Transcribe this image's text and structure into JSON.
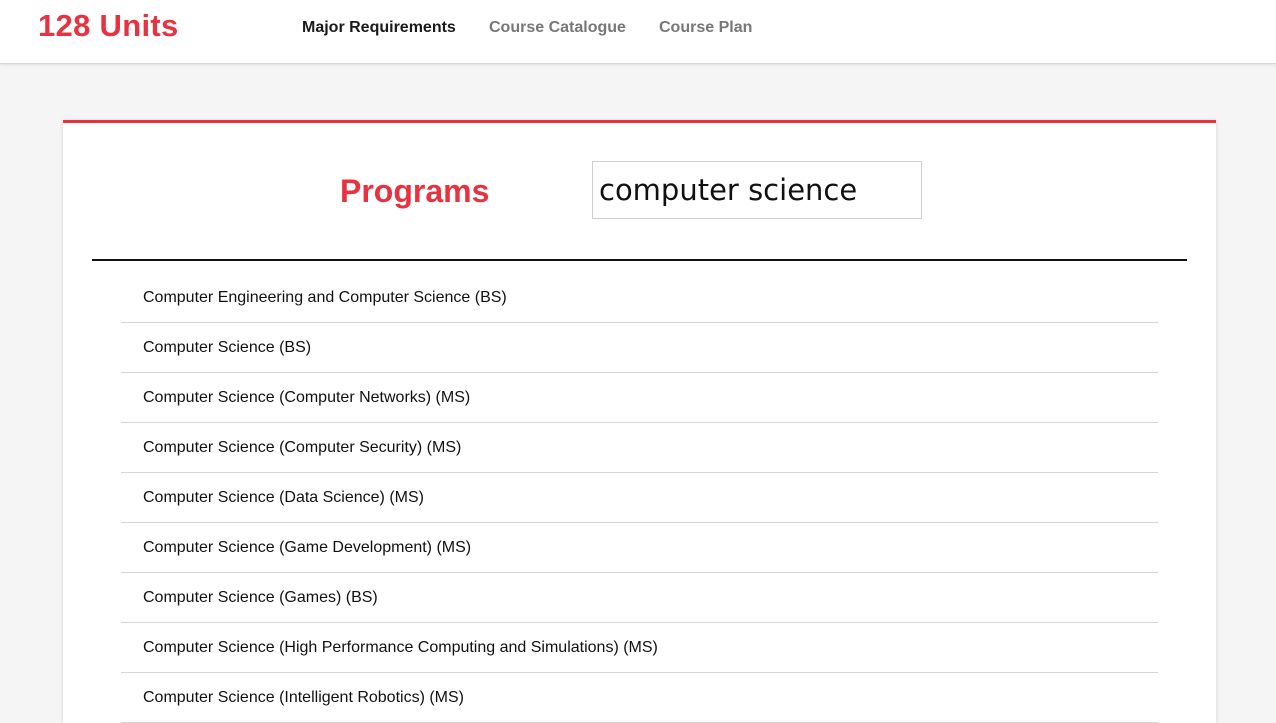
{
  "colors": {
    "accent": "#e8323f",
    "nav_active": "#1a1a1a",
    "nav_inactive": "#777777"
  },
  "header": {
    "brand": "128 Units",
    "nav": [
      {
        "label": "Major Requirements",
        "active": true
      },
      {
        "label": "Course Catalogue",
        "active": false
      },
      {
        "label": "Course Plan",
        "active": false
      }
    ]
  },
  "main": {
    "title": "Programs",
    "search": {
      "value": "computer science",
      "placeholder": ""
    },
    "programs": [
      "Computer Engineering and Computer Science (BS)",
      "Computer Science (BS)",
      "Computer Science (Computer Networks) (MS)",
      "Computer Science (Computer Security) (MS)",
      "Computer Science (Data Science) (MS)",
      "Computer Science (Game Development) (MS)",
      "Computer Science (Games) (BS)",
      "Computer Science (High Performance Computing and Simulations) (MS)",
      "Computer Science (Intelligent Robotics) (MS)"
    ]
  }
}
